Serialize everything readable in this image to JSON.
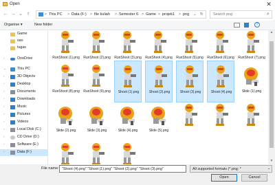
{
  "window": {
    "title": "Open",
    "close_glyph": "✕"
  },
  "nav_buttons": {
    "back": "←",
    "forward": "→",
    "recent": "⌄",
    "up": "↑"
  },
  "address": {
    "crumbs": [
      "This PC",
      "Data (F:)",
      "file kuliah",
      "Semester 6",
      "Game",
      "projek1",
      "png"
    ],
    "separator": ">",
    "dropdown": "⌄",
    "refresh": "↻"
  },
  "search": {
    "placeholder": "Search png",
    "icon": "search-icon"
  },
  "toolbar": {
    "organise": "Organise ▾",
    "new_folder": "New folder"
  },
  "nav": {
    "items": [
      {
        "label": "Game",
        "icon": "folder-icon",
        "selected": false
      },
      {
        "label": "sao",
        "icon": "folder-icon",
        "selected": false
      },
      {
        "label": "tugas",
        "icon": "folder-icon",
        "selected": false
      },
      {
        "label": "OneDrive",
        "icon": "cloud-icon",
        "selected": false
      },
      {
        "label": "This PC",
        "icon": "computer-icon",
        "selected": false
      },
      {
        "label": "3D Objects",
        "icon": "cube-icon",
        "selected": false
      },
      {
        "label": "Desktop",
        "icon": "desktop-icon",
        "selected": false
      },
      {
        "label": "Documents",
        "icon": "documents-icon",
        "selected": false
      },
      {
        "label": "Downloads",
        "icon": "downloads-icon",
        "selected": false
      },
      {
        "label": "Music",
        "icon": "music-icon",
        "selected": false
      },
      {
        "label": "Pictures",
        "icon": "pictures-icon",
        "selected": false
      },
      {
        "label": "Videos",
        "icon": "videos-icon",
        "selected": false
      },
      {
        "label": "Local Disk (C:)",
        "icon": "drive-icon",
        "selected": false
      },
      {
        "label": "CD Drive (D:)",
        "icon": "cd-icon",
        "selected": false
      },
      {
        "label": "Software (E:)",
        "icon": "drive-icon",
        "selected": false
      },
      {
        "label": "Data (F:)",
        "icon": "drive-icon",
        "selected": true
      }
    ]
  },
  "files": [
    {
      "name": "RunShoot (1).png",
      "selected": false
    },
    {
      "name": "RunShoot (2).png",
      "selected": false
    },
    {
      "name": "RunShoot (3).png",
      "selected": false
    },
    {
      "name": "RunShoot (4).png",
      "selected": false
    },
    {
      "name": "RunShoot (5).png",
      "selected": false
    },
    {
      "name": "RunShoot (6).png",
      "selected": false
    },
    {
      "name": "RunShoot (7).png",
      "selected": false
    },
    {
      "name": "RunShoot (8).png",
      "selected": false
    },
    {
      "name": "RunShoot (9).png",
      "selected": false
    },
    {
      "name": "Shoot (1).png",
      "selected": true
    },
    {
      "name": "Shoot (2).png",
      "selected": true
    },
    {
      "name": "Shoot (3).png",
      "selected": true
    },
    {
      "name": "Shoot (4).png",
      "selected": true
    },
    {
      "name": "Slide (1).png",
      "selected": false
    },
    {
      "name": "Slide (2).png",
      "selected": false
    },
    {
      "name": "Slide (3).png",
      "selected": false
    },
    {
      "name": "Slide (4).png",
      "selected": false
    },
    {
      "name": "Slide (5).png",
      "selected": false
    },
    {
      "name": "",
      "selected": false
    },
    {
      "name": "",
      "selected": false
    },
    {
      "name": "",
      "selected": false
    },
    {
      "name": "",
      "selected": false
    },
    {
      "name": "",
      "selected": false
    },
    {
      "name": "",
      "selected": false
    }
  ],
  "bottom": {
    "file_name_label": "File name:",
    "file_name_value": "\"Shoot (4).png\" \"Shoot (1).png\" \"Shoot (2).png\" \"Shoot (3).png\"",
    "filter_value": "All supported formats (*.png; *",
    "filter_arrow": "⌄",
    "open": "Open",
    "cancel": "Cancel"
  },
  "scrollbar": {
    "up": "▲",
    "down": "▼"
  },
  "colors": {
    "selection": "#cce8ff",
    "selection_border": "#99d1ff",
    "accent": "#0078d7",
    "folder": "#e8c35a"
  }
}
